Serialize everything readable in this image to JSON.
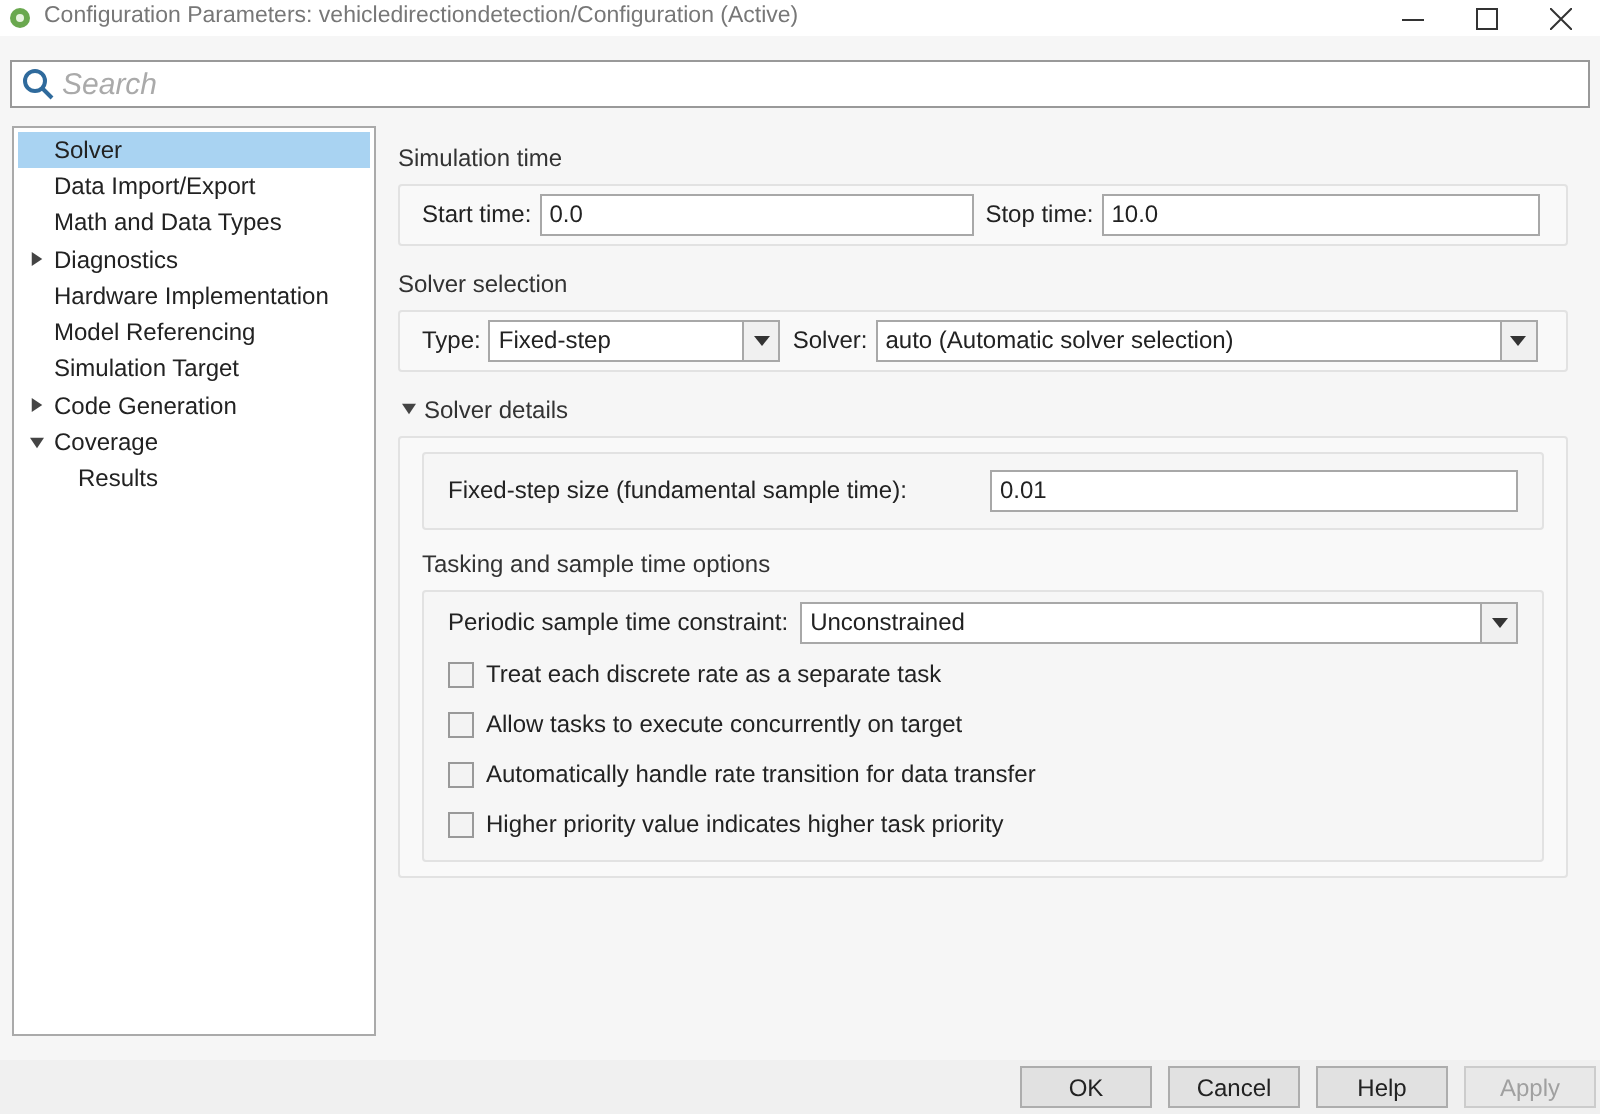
{
  "window": {
    "title": "Configuration Parameters: vehicledirectiondetection/Configuration (Active)"
  },
  "search": {
    "placeholder": "Search"
  },
  "sidebar": {
    "items": [
      {
        "label": "Solver",
        "selected": true
      },
      {
        "label": "Data Import/Export",
        "selected": false
      },
      {
        "label": "Math and Data Types",
        "selected": false
      },
      {
        "label": "Diagnostics",
        "selected": false,
        "expanded": false
      },
      {
        "label": "Hardware Implementation",
        "selected": false
      },
      {
        "label": "Model Referencing",
        "selected": false
      },
      {
        "label": "Simulation Target",
        "selected": false
      },
      {
        "label": "Code Generation",
        "selected": false,
        "expanded": false
      },
      {
        "label": "Coverage",
        "selected": false,
        "expanded": true,
        "children": [
          {
            "label": "Results",
            "selected": false
          }
        ]
      }
    ]
  },
  "simulation_time": {
    "title": "Simulation time",
    "start_label": "Start time:",
    "start_value": "0.0",
    "stop_label": "Stop time:",
    "stop_value": "10.0"
  },
  "solver_selection": {
    "title": "Solver selection",
    "type_label": "Type:",
    "type_value": "Fixed-step",
    "solver_label": "Solver:",
    "solver_value": "auto (Automatic solver selection)"
  },
  "solver_details": {
    "title": "Solver details",
    "expanded": true,
    "step_label": "Fixed-step size (fundamental sample time):",
    "step_value": "0.01",
    "tasking": {
      "title": "Tasking and sample time options",
      "constraint_label": "Periodic sample time constraint:",
      "constraint_value": "Unconstrained",
      "options": [
        {
          "label": "Treat each discrete rate as a separate task",
          "checked": false
        },
        {
          "label": "Allow tasks to execute concurrently on target",
          "checked": false
        },
        {
          "label": "Automatically handle rate transition for data transfer",
          "checked": false
        },
        {
          "label": "Higher priority value indicates higher task priority",
          "checked": false
        }
      ]
    }
  },
  "buttons": [
    {
      "label": "OK",
      "disabled": false
    },
    {
      "label": "Cancel",
      "disabled": false
    },
    {
      "label": "Help",
      "disabled": false
    },
    {
      "label": "Apply",
      "disabled": true
    }
  ]
}
